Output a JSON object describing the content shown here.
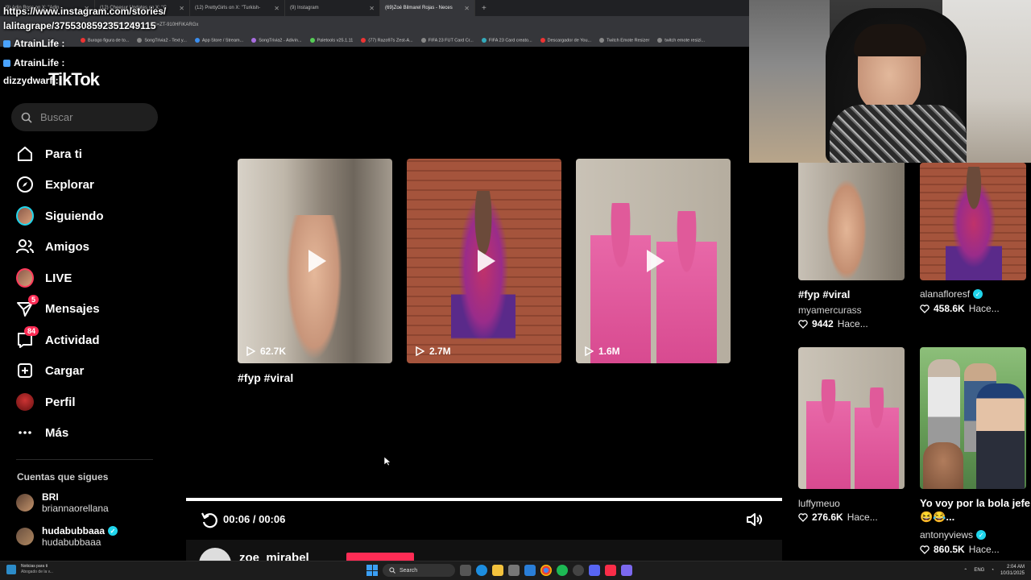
{
  "browser": {
    "tabs": [
      {
        "title": "(9) Adin Ross on X: \"Adin",
        "active": false
      },
      {
        "title": "(12) Cheesur Updates on X: \"C",
        "active": false
      },
      {
        "title": "(12) PrettyGirls on X: \"Turkish-",
        "active": false
      },
      {
        "title": "(9) Instagram",
        "active": false
      },
      {
        "title": "(69)Zoé Bilmarel Rojas - Neces",
        "active": true
      }
    ],
    "url": "1588463813437_r=1&_t=ZT-910HFiKARGx",
    "bookmarks": [
      "Burago figura de to...",
      "SongTrivia2 - Text y...",
      "App Store / Stream...",
      "SongTrivia2 - Adivin...",
      "Paletools v25.1.11",
      "(77) Razo97s Zest-A...",
      "FIFA 23 FUT Card Cr...",
      "FIFA 23 Card creato...",
      "Descargador de You...",
      "Twitch Emote Resizer",
      "twitch emote resizi..."
    ]
  },
  "chat_overlay": {
    "url_line1": "https://www.instagram.com/stories/",
    "url_line2": "lalitagrape/3755308592351249115",
    "lines": [
      {
        "user": "AtrainLife :",
        "msg": ""
      },
      {
        "user": "AtrainLife :",
        "msg": ""
      },
      {
        "user": "dizzydwarf :",
        "msg": ""
      }
    ]
  },
  "tiktok": {
    "logo": "TikTok",
    "search_placeholder": "Buscar",
    "nav": [
      {
        "label": "Para ti",
        "icon": "home-icon"
      },
      {
        "label": "Explorar",
        "icon": "compass-icon"
      },
      {
        "label": "Siguiendo",
        "icon": "following-avatar-icon"
      },
      {
        "label": "Amigos",
        "icon": "friends-icon"
      },
      {
        "label": "LIVE",
        "icon": "live-avatar-icon"
      },
      {
        "label": "Mensajes",
        "icon": "messages-icon",
        "badge": "5"
      },
      {
        "label": "Actividad",
        "icon": "activity-icon",
        "badge": "84"
      },
      {
        "label": "Cargar",
        "icon": "upload-icon"
      },
      {
        "label": "Perfil",
        "icon": "profile-icon"
      },
      {
        "label": "Más",
        "icon": "more-icon"
      }
    ],
    "following_title": "Cuentas que sigues",
    "following": [
      {
        "name": "BRI",
        "handle": "briannaorellana",
        "verified": false
      },
      {
        "name": "hudabubbaaa",
        "handle": "hudabubbaaa",
        "verified": true
      }
    ]
  },
  "center": {
    "cards": [
      {
        "views": "62.7K"
      },
      {
        "views": "2.7M"
      },
      {
        "views": "1.6M"
      }
    ],
    "caption": "#fyp #viral"
  },
  "player": {
    "time": "00:06 / 00:06",
    "progress": 1.0,
    "author": "zoe_mirabel"
  },
  "right": [
    {
      "caption": "#fyp #viral",
      "user": "myamercurass",
      "verified": false,
      "likes": "9442",
      "time": "Hace..."
    },
    {
      "caption": "",
      "user": "alanafloresf",
      "verified": true,
      "likes": "458.6K",
      "time": "Hace..."
    },
    {
      "caption": "",
      "user": "luffymeuo",
      "verified": false,
      "likes": "276.6K",
      "time": "Hace..."
    },
    {
      "caption": "Yo voy por la bola jefe 😆😂...",
      "user": "antonyviews",
      "verified": true,
      "likes": "860.5K",
      "time": "Hace..."
    }
  ],
  "taskbar": {
    "news_title": "Noticias para ti",
    "news_sub": "Abogado de la v...",
    "search": "Search",
    "lang": "ENG",
    "time": "2:04 AM",
    "date": "10/31/2025"
  },
  "colors": {
    "accent": "#fe2c55",
    "verified": "#20d5ec",
    "bg": "#000000"
  }
}
